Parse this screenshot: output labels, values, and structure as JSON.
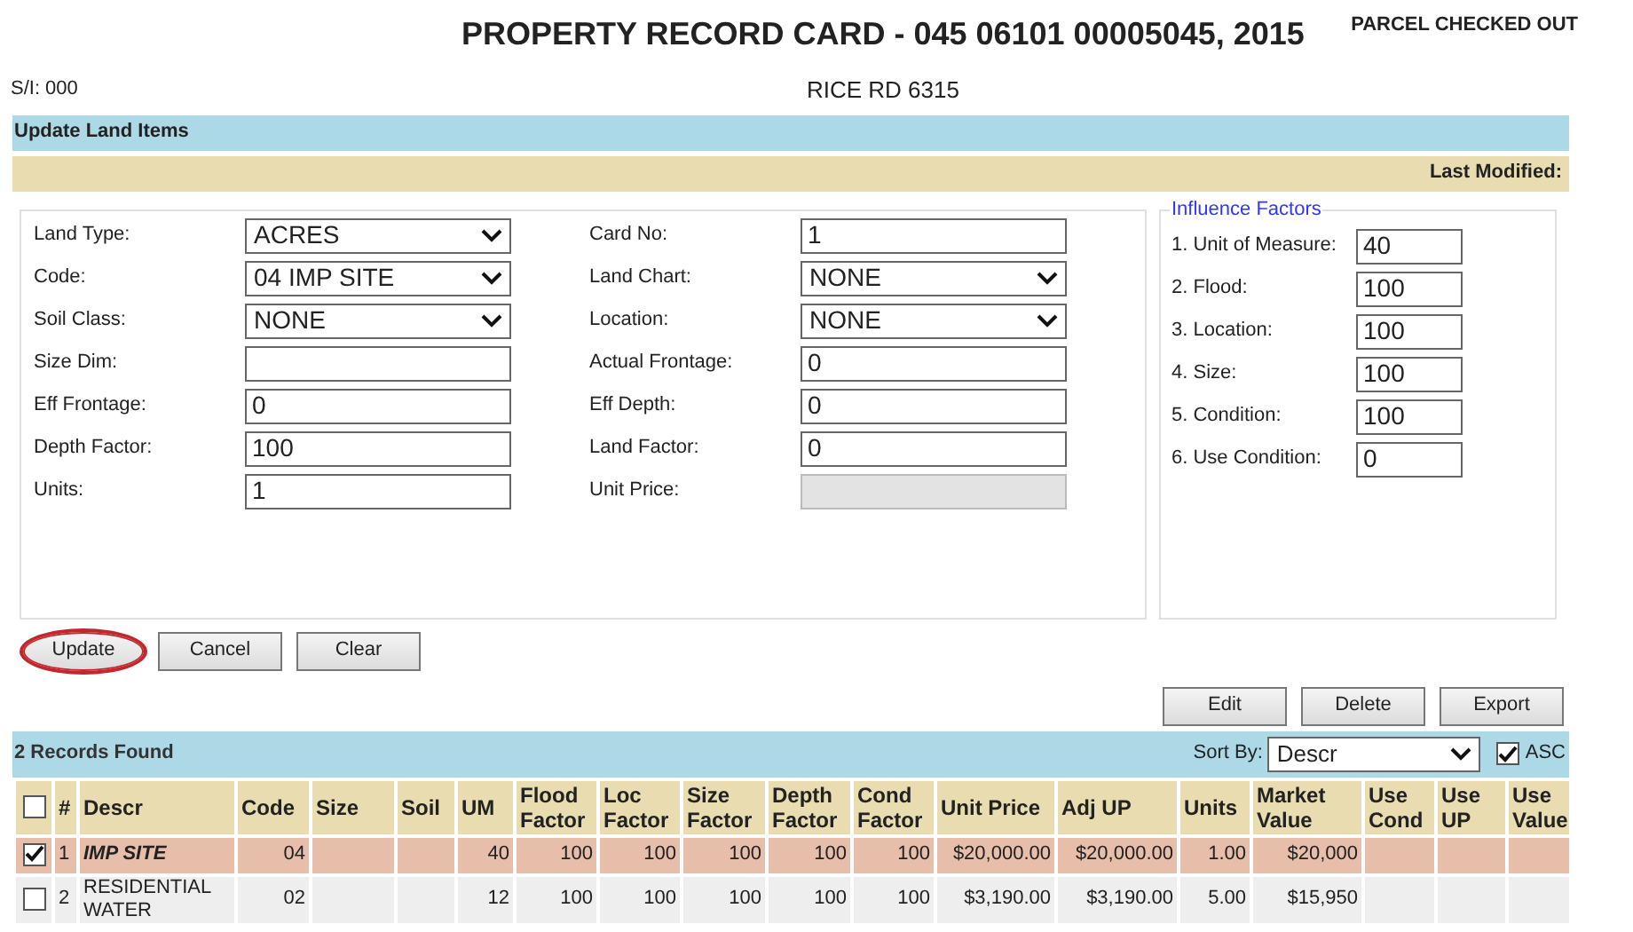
{
  "header": {
    "title": "PROPERTY RECORD CARD - 045 06101 00005045, 2015",
    "status": "PARCEL CHECKED OUT",
    "si": "S/I: 000",
    "address": "RICE RD 6315"
  },
  "section_title": "Update Land Items",
  "last_modified": "Last Modified:",
  "form": {
    "left": [
      {
        "label": "Land Type:",
        "kind": "select",
        "value": "ACRES"
      },
      {
        "label": "Code:",
        "kind": "select",
        "value": "04 IMP SITE"
      },
      {
        "label": "Soil Class:",
        "kind": "select",
        "value": "NONE"
      },
      {
        "label": "Size Dim:",
        "kind": "text"
      },
      {
        "label": "Eff Frontage:",
        "kind": "text",
        "value": "0"
      },
      {
        "label": "Depth Factor:",
        "kind": "text",
        "value": "100"
      },
      {
        "label": "Units:",
        "kind": "text",
        "value": "1"
      }
    ],
    "right": [
      {
        "label": "Card No:",
        "kind": "text",
        "value": "1"
      },
      {
        "label": "Land Chart:",
        "kind": "select",
        "value": "NONE"
      },
      {
        "label": "Location:",
        "kind": "select",
        "value": "NONE"
      },
      {
        "label": "Actual Frontage:",
        "kind": "text",
        "value": "0"
      },
      {
        "label": "Eff Depth:",
        "kind": "text",
        "value": "0"
      },
      {
        "label": "Land Factor:",
        "kind": "text",
        "value": "0"
      },
      {
        "label": "Unit Price:",
        "kind": "text",
        "disabled": true
      }
    ]
  },
  "influence_factors": {
    "legend": "Influence Factors",
    "items": [
      {
        "label": "1. Unit of Measure:",
        "value": "40"
      },
      {
        "label": "2. Flood:",
        "value": "100"
      },
      {
        "label": "3. Location:",
        "value": "100"
      },
      {
        "label": "4. Size:",
        "value": "100"
      },
      {
        "label": "5. Condition:",
        "value": "100"
      },
      {
        "label": "6. Use Condition:",
        "value": "0"
      }
    ]
  },
  "form_buttons": [
    {
      "label": "Update",
      "circled": true
    },
    {
      "label": "Cancel",
      "circled": false
    },
    {
      "label": "Clear",
      "circled": false
    }
  ],
  "table_buttons": [
    "Edit",
    "Delete",
    "Export"
  ],
  "records": {
    "count": "2 Records Found",
    "sort_label": "Sort By:",
    "sort_value": "Descr",
    "asc_checked": true,
    "asc_label": "ASC",
    "header_checked": false,
    "columns": [
      "#",
      "Descr",
      "Code",
      "Size",
      "Soil",
      "UM",
      "Flood Factor",
      "Loc Factor",
      "Size Factor",
      "Depth Factor",
      "Cond Factor",
      "Unit Price",
      "Adj UP",
      "Units",
      "Market Value",
      "Use Cond",
      "Use UP",
      "Use Value"
    ],
    "rows": [
      {
        "selected": true,
        "checked": true,
        "cells": [
          "1",
          "IMP SITE",
          "04",
          "",
          "",
          "40",
          "100",
          "100",
          "100",
          "100",
          "100",
          "$20,000.00",
          "$20,000.00",
          "1.00",
          "$20,000",
          "",
          "",
          ""
        ]
      },
      {
        "selected": false,
        "checked": false,
        "cells": [
          "2",
          "RESIDENTIAL WATER",
          "02",
          "",
          "",
          "12",
          "100",
          "100",
          "100",
          "100",
          "100",
          "$3,190.00",
          "$3,190.00",
          "5.00",
          "$15,950",
          "",
          "",
          ""
        ]
      }
    ]
  }
}
